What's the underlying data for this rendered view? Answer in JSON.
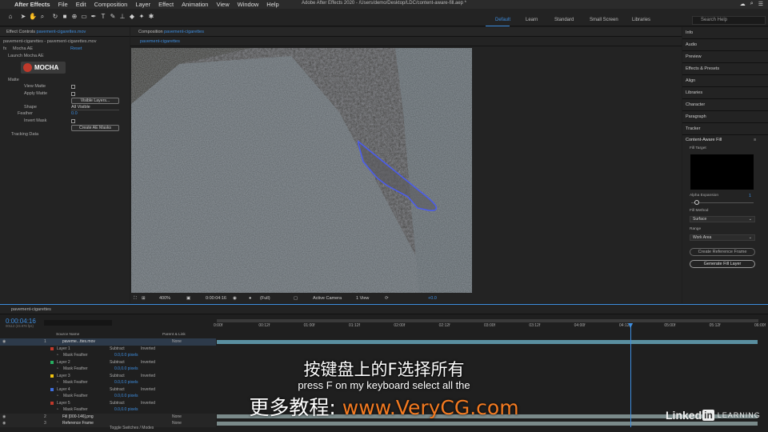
{
  "menubar": {
    "app": "After Effects",
    "items": [
      "File",
      "Edit",
      "Composition",
      "Layer",
      "Effect",
      "Animation",
      "View",
      "Window",
      "Help"
    ]
  },
  "window_title": "Adobe After Effects 2020 - /Users/demo/Desktop/LDC/content-aware-fill.aep *",
  "workspaces": {
    "default": "Default",
    "learn": "Learn",
    "standard": "Standard",
    "small_screen": "Small Screen",
    "libraries": "Libraries"
  },
  "search_help": "Search Help",
  "effect_controls": {
    "tab_prefix": "Effect Controls",
    "tab_file": "pavement-cigarettes.mov",
    "source_label": "pavement-cigarettes - pavement-cigarettes.mov",
    "effect_name": "Mocha AE",
    "reset": "Reset",
    "launch": "Launch Mocha AE",
    "logo": "MOCHA",
    "matte": "Matte",
    "view_matte": "View Matte",
    "apply_matte": "Apply Matte",
    "visible_layers_btn": "Visible Layers...",
    "shape": "Shape",
    "shape_value": "All Visible",
    "feather": "Feather",
    "feather_value": "0.0",
    "invert_mask": "Invert Mask",
    "create_masks_btn": "Create AE Masks",
    "tracking_data": "Tracking Data"
  },
  "composition": {
    "tab_prefix": "Composition",
    "tab_name": "pavement-cigarettes",
    "subtab": "pavement-cigarettes",
    "zoom": "400%",
    "timecode": "0:00:04:16",
    "resolution": "(Full)",
    "camera": "Active Camera",
    "views": "1 View",
    "exposure": "+0.0"
  },
  "right_panels": [
    "Info",
    "Audio",
    "Preview",
    "Effects & Presets",
    "Align",
    "Libraries",
    "Character",
    "Paragraph",
    "Tracker"
  ],
  "content_aware_fill": {
    "title": "Content-Aware Fill",
    "fill_target": "Fill Target",
    "alpha_expansion": "Alpha Expansion",
    "alpha_value": "1",
    "fill_method": "Fill Method",
    "fill_method_value": "Surface",
    "range": "Range",
    "range_value": "Work Area",
    "create_ref_btn": "Create Reference Frame",
    "generate_btn": "Generate Fill Layer"
  },
  "timeline": {
    "tab": "pavement-cigarettes",
    "timecode": "0:00:04:16",
    "frame_info": "00112 (23.976 fps)",
    "col_source": "Source Name",
    "col_parent": "Parent & Link",
    "ticks": [
      "0:00f",
      "00:12f",
      "01:00f",
      "01:12f",
      "02:00f",
      "02:12f",
      "03:00f",
      "03:12f",
      "04:00f",
      "04:12f",
      "05:00f",
      "05:12f",
      "06:00f"
    ],
    "playhead_fraction": 0.765,
    "rows": [
      {
        "num": "1",
        "name": "paveme...ttes.mov",
        "mode": "",
        "parent": "None",
        "kind": "layer"
      },
      {
        "num": "",
        "name": "Layer 1",
        "mode": "Subtract",
        "extra": "Inverted",
        "kind": "mask",
        "color": "#c0392b"
      },
      {
        "num": "",
        "name": "Mask Feather",
        "value": "0.0,0.0 pixels",
        "kind": "prop"
      },
      {
        "num": "",
        "name": "Layer 2",
        "mode": "Subtract",
        "extra": "Inverted",
        "kind": "mask",
        "color": "#27ae60"
      },
      {
        "num": "",
        "name": "Mask Feather",
        "value": "0.0,0.0 pixels",
        "kind": "prop"
      },
      {
        "num": "",
        "name": "Layer 3",
        "mode": "Subtract",
        "extra": "Inverted",
        "kind": "mask",
        "color": "#f1c40f"
      },
      {
        "num": "",
        "name": "Mask Feather",
        "value": "0.0,0.0 pixels",
        "kind": "prop"
      },
      {
        "num": "",
        "name": "Layer 4",
        "mode": "Subtract",
        "extra": "Inverted",
        "kind": "mask",
        "color": "#3e6fe0"
      },
      {
        "num": "",
        "name": "Mask Feather",
        "value": "0.0,0.0 pixels",
        "kind": "prop"
      },
      {
        "num": "",
        "name": "Layer 5",
        "mode": "Subtract",
        "extra": "Inverted",
        "kind": "mask",
        "color": "#c0392b"
      },
      {
        "num": "",
        "name": "Mask Feather",
        "value": "0.0,0.0 pixels",
        "kind": "prop"
      },
      {
        "num": "2",
        "name": "Fill [000-146].png",
        "mode": "",
        "parent": "None",
        "kind": "layer"
      },
      {
        "num": "3",
        "name": "Reference Frame",
        "mode": "",
        "parent": "None",
        "kind": "layer"
      }
    ],
    "toggle": "Toggle Switches / Modes"
  },
  "subtitles": {
    "zh": "按键盘上的F选择所有",
    "en": "press F on my keyboard select all the",
    "promo_prefix": "更多教程: ",
    "promo_url": "www.VeryCG.com"
  },
  "watermark": {
    "brand": "Linked",
    "in": "in",
    "learning": "LEARNING"
  },
  "colors": {
    "accent": "#3e8ee0",
    "promo": "#f47a20"
  }
}
